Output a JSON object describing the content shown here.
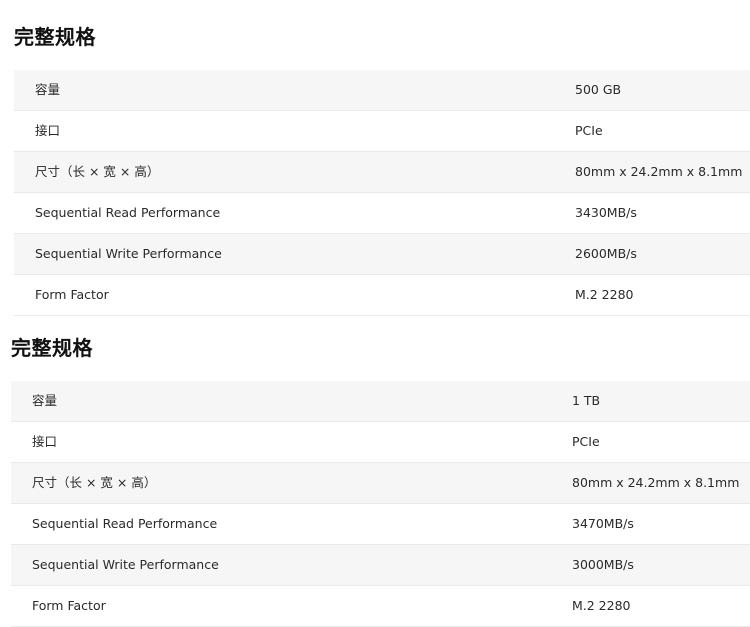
{
  "sections": [
    {
      "title": "完整规格",
      "rows": [
        {
          "label": "容量",
          "value": "500 GB"
        },
        {
          "label": "接口",
          "value": "PCIe"
        },
        {
          "label": "尺寸（长 × 宽 × 高）",
          "value": "80mm x 24.2mm x 8.1mm"
        },
        {
          "label": "Sequential Read Performance",
          "value": "3430MB/s"
        },
        {
          "label": "Sequential Write Performance",
          "value": "2600MB/s"
        },
        {
          "label": "Form Factor",
          "value": "M.2 2280"
        }
      ]
    },
    {
      "title": "完整规格",
      "rows": [
        {
          "label": "容量",
          "value": "1 TB"
        },
        {
          "label": "接口",
          "value": "PCIe"
        },
        {
          "label": "尺寸（长 × 宽 × 高）",
          "value": "80mm x 24.2mm x 8.1mm"
        },
        {
          "label": "Sequential Read Performance",
          "value": "3470MB/s"
        },
        {
          "label": "Sequential Write Performance",
          "value": "3000MB/s"
        },
        {
          "label": "Form Factor",
          "value": "M.2 2280"
        }
      ]
    }
  ]
}
